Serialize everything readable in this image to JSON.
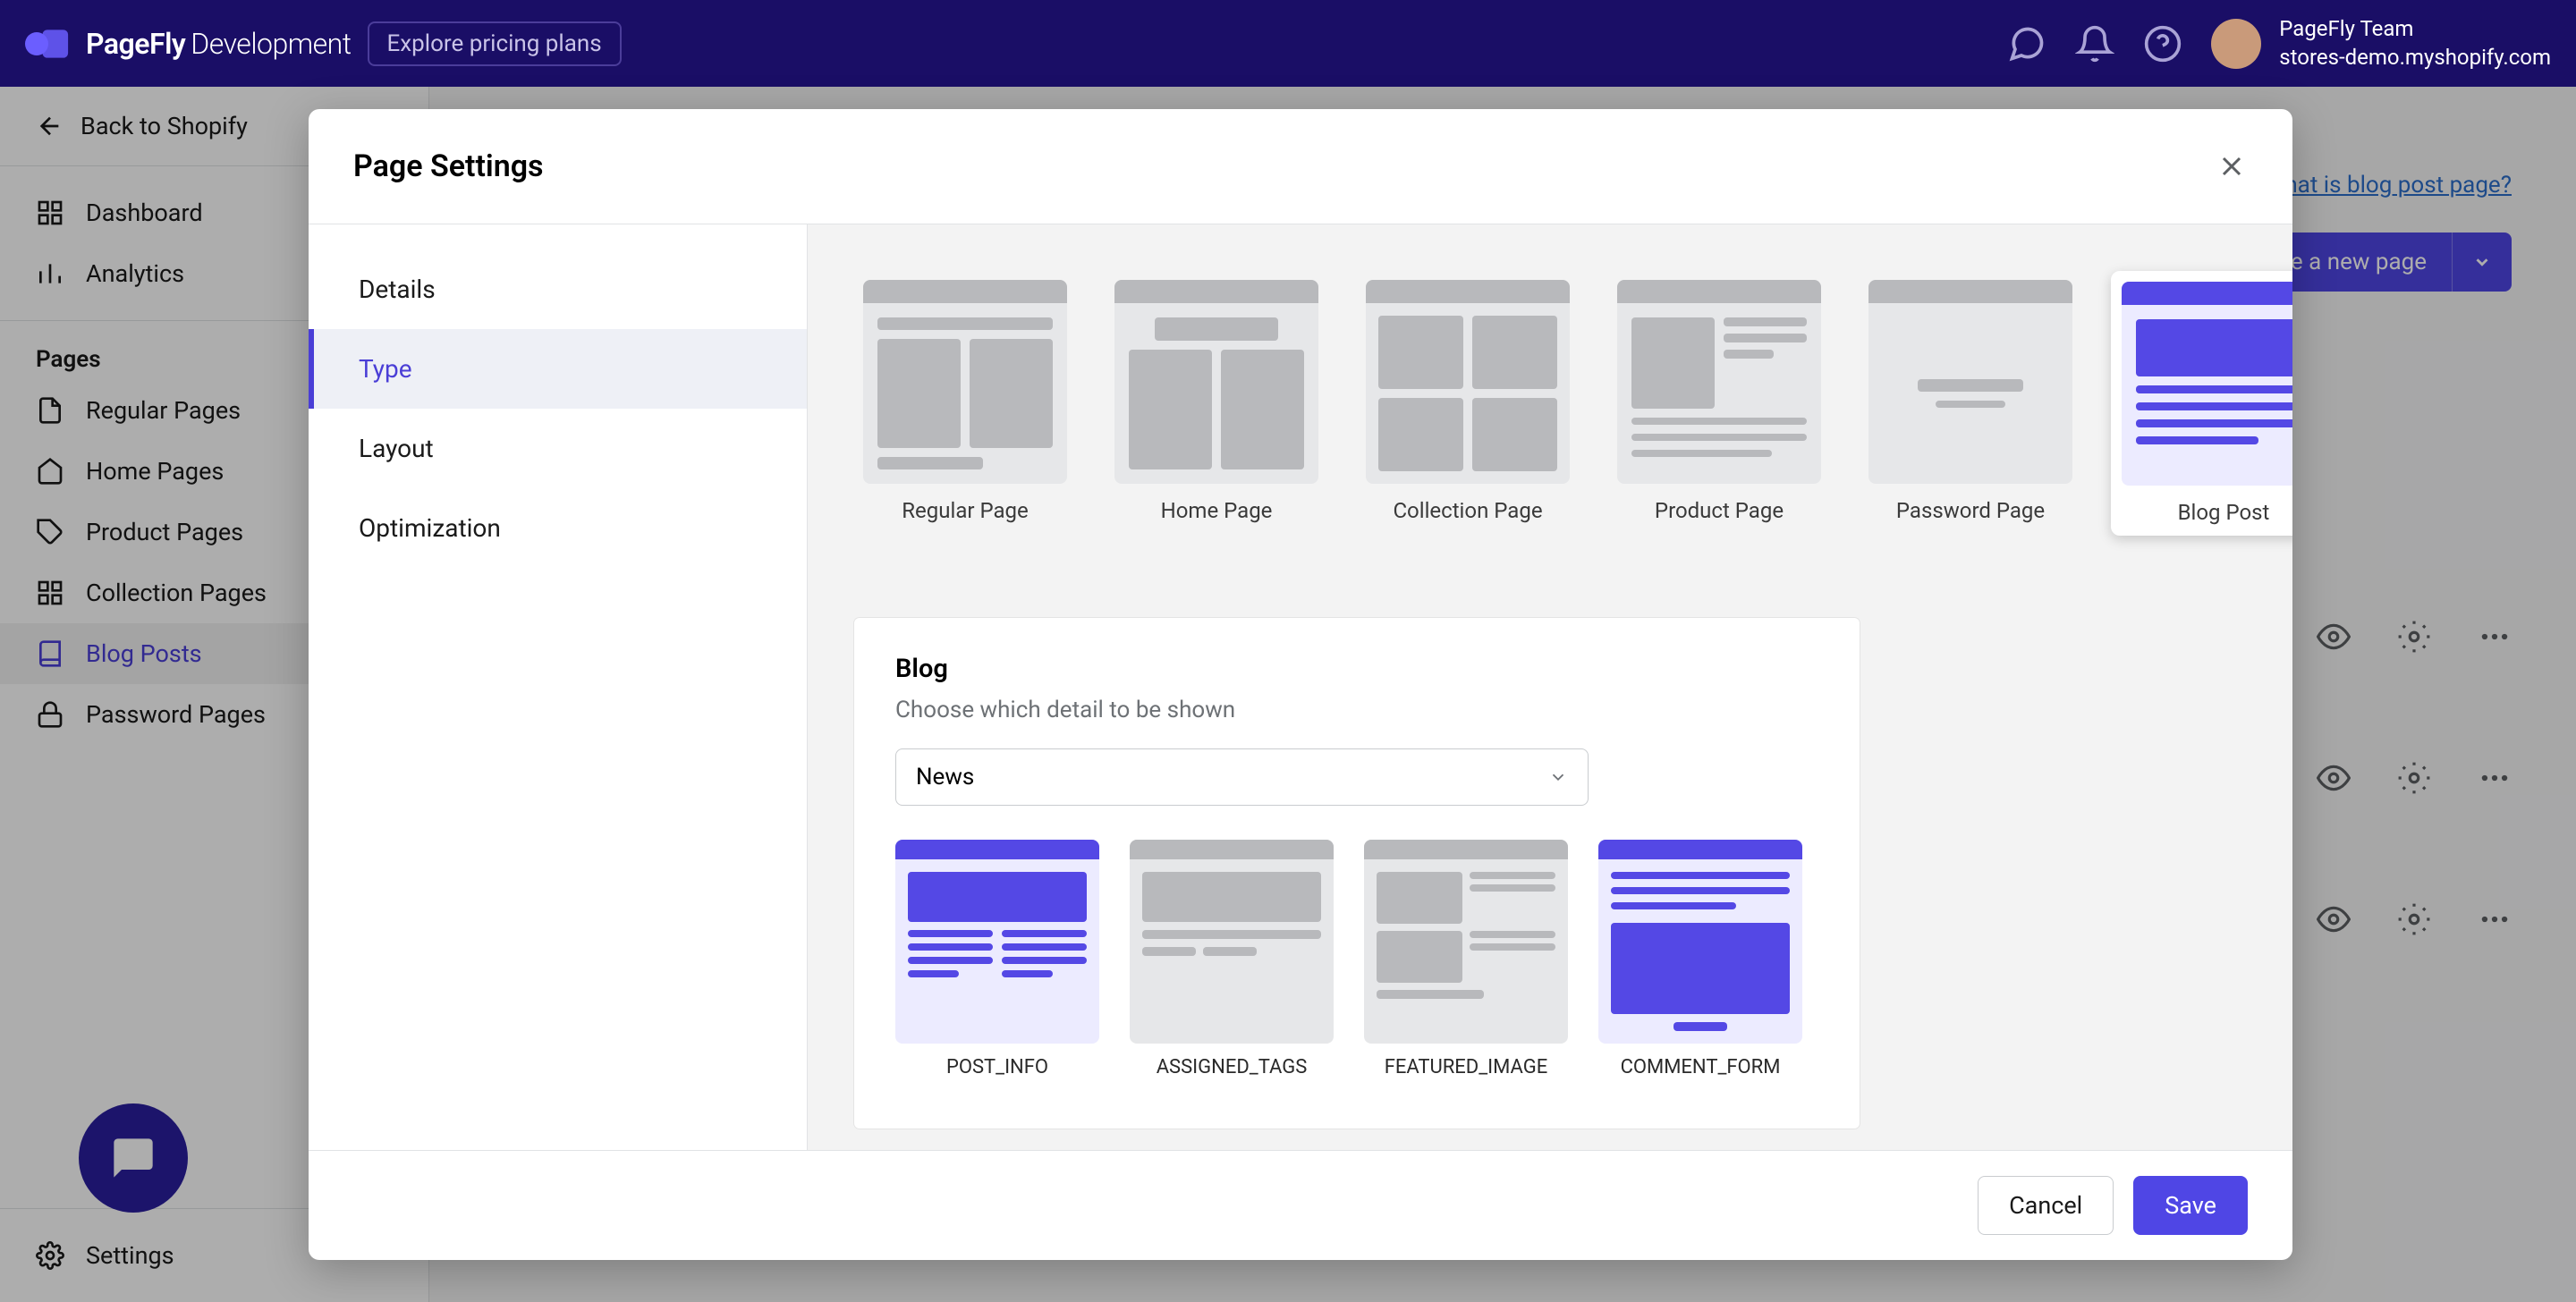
{
  "topbar": {
    "brand_name": "PageFly",
    "brand_suffix": "Development",
    "explore_label": "Explore pricing plans",
    "user_name": "PageFly Team",
    "user_store": "stores-demo.myshopify.com"
  },
  "sidebar": {
    "back_label": "Back to Shopify",
    "primary": [
      {
        "label": "Dashboard"
      },
      {
        "label": "Analytics"
      }
    ],
    "pages_heading": "Pages",
    "pages": [
      {
        "label": "Regular Pages"
      },
      {
        "label": "Home Pages"
      },
      {
        "label": "Product Pages"
      },
      {
        "label": "Collection Pages"
      },
      {
        "label": "Blog Posts",
        "active": true
      },
      {
        "label": "Password Pages"
      }
    ],
    "settings_label": "Settings"
  },
  "main": {
    "help_link": "What is blog post page?",
    "create_btn": "Create a new page"
  },
  "modal": {
    "title": "Page Settings",
    "tabs": [
      {
        "label": "Details"
      },
      {
        "label": "Type",
        "active": true
      },
      {
        "label": "Layout"
      },
      {
        "label": "Optimization"
      }
    ],
    "types": [
      {
        "label": "Regular Page"
      },
      {
        "label": "Home Page"
      },
      {
        "label": "Collection Page"
      },
      {
        "label": "Product Page"
      },
      {
        "label": "Password Page"
      },
      {
        "label": "Blog Post",
        "selected": true
      }
    ],
    "detail_panel": {
      "title": "Blog",
      "subtitle": "Choose which detail to be shown",
      "select_value": "News",
      "options": [
        {
          "label": "POST_INFO",
          "accent": true
        },
        {
          "label": "ASSIGNED_TAGS",
          "accent": false
        },
        {
          "label": "FEATURED_IMAGE",
          "accent": false
        },
        {
          "label": "COMMENT_FORM",
          "accent": true
        }
      ]
    },
    "footer": {
      "cancel": "Cancel",
      "save": "Save"
    }
  }
}
